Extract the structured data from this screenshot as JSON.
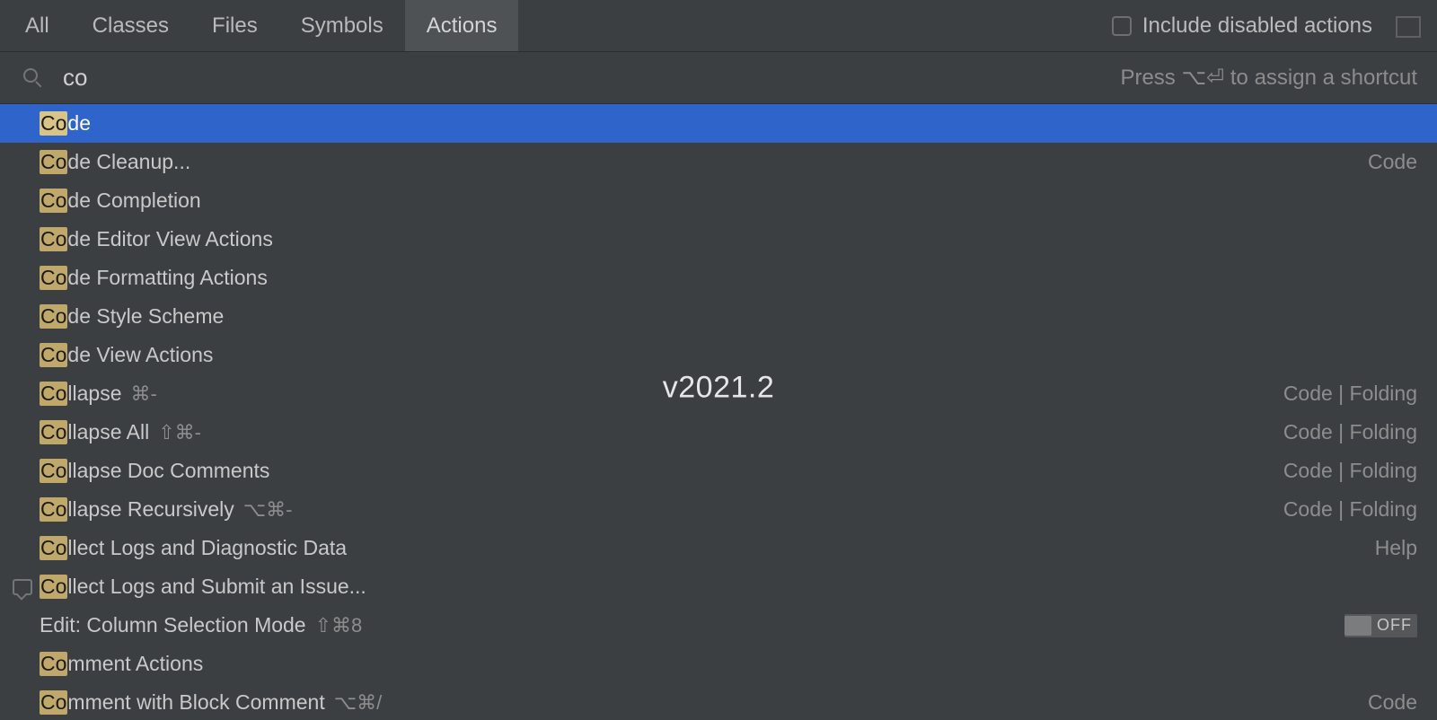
{
  "tabs": {
    "all": "All",
    "classes": "Classes",
    "files": "Files",
    "symbols": "Symbols",
    "actions": "Actions"
  },
  "include_disabled_label": "Include disabled actions",
  "search": {
    "query": "co",
    "hint": "Press ⌥⏎ to assign a shortcut"
  },
  "version_watermark": "v2021.2",
  "results": [
    {
      "highlight": "Co",
      "rest": "de",
      "selected": true
    },
    {
      "highlight": "Co",
      "rest": "de Cleanup...",
      "right": "Code"
    },
    {
      "highlight": "Co",
      "rest": "de Completion"
    },
    {
      "highlight": "Co",
      "rest": "de Editor View Actions"
    },
    {
      "highlight": "Co",
      "rest": "de Formatting Actions"
    },
    {
      "highlight": "Co",
      "rest": "de Style Scheme"
    },
    {
      "highlight": "Co",
      "rest": "de View Actions"
    },
    {
      "highlight": "Co",
      "rest": "llapse",
      "shortcut": "⌘-",
      "right": "Code | Folding"
    },
    {
      "highlight": "Co",
      "rest": "llapse All",
      "shortcut": "⇧⌘-",
      "right": "Code | Folding"
    },
    {
      "highlight": "Co",
      "rest": "llapse Doc Comments",
      "right": "Code | Folding"
    },
    {
      "highlight": "Co",
      "rest": "llapse Recursively",
      "shortcut": "⌥⌘-",
      "right": "Code | Folding"
    },
    {
      "highlight": "Co",
      "rest": "llect Logs and Diagnostic Data",
      "right": "Help"
    },
    {
      "highlight": "Co",
      "rest": "llect Logs and Submit an Issue...",
      "icon": "speech"
    },
    {
      "highlight": "",
      "rest": "Edit: Column Selection Mode",
      "shortcut": "⇧⌘8",
      "toggle": "OFF"
    },
    {
      "highlight": "Co",
      "rest": "mment Actions"
    },
    {
      "highlight": "Co",
      "rest": "mment with Block Comment",
      "shortcut": "⌥⌘/",
      "right": "Code"
    }
  ]
}
